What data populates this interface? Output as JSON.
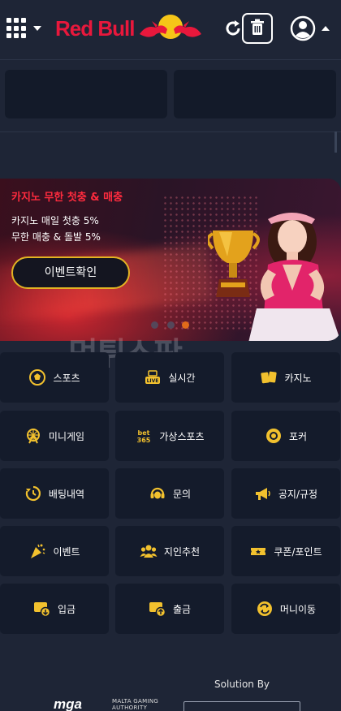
{
  "header": {
    "logo_text": "Red Bull",
    "icons": {
      "menu": "grid-icon",
      "refresh": "refresh-icon",
      "trash": "trash-icon",
      "user": "user-icon"
    }
  },
  "banner": {
    "title": "카지노 무한 첫충 & 매충",
    "line1": "카지노 매일 첫충 5%",
    "line2": "무한 매충 & 돌발 5%",
    "button_label": "이벤트확인",
    "pager": {
      "count": 3,
      "active_index": 2
    },
    "colors": {
      "title": "#ff2b3e",
      "button_border": "#e2b323",
      "active_dot": "#e06a1a"
    }
  },
  "watermark": {
    "text": "먹튀스팟"
  },
  "menu": [
    {
      "label": "스포츠",
      "icon": "soccer-ball-icon"
    },
    {
      "label": "실시간",
      "icon": "live-icon"
    },
    {
      "label": "카지노",
      "icon": "cards-icon"
    },
    {
      "label": "미니게임",
      "icon": "ferris-wheel-icon"
    },
    {
      "label": "가상스포츠",
      "icon": "bet365-icon"
    },
    {
      "label": "포커",
      "icon": "poker-chip-icon"
    },
    {
      "label": "배팅내역",
      "icon": "history-icon"
    },
    {
      "label": "문의",
      "icon": "support-icon"
    },
    {
      "label": "공지/규정",
      "icon": "megaphone-icon"
    },
    {
      "label": "이벤트",
      "icon": "party-popper-icon"
    },
    {
      "label": "지인추천",
      "icon": "people-icon"
    },
    {
      "label": "쿠폰/포인트",
      "icon": "ticket-icon"
    },
    {
      "label": "입금",
      "icon": "deposit-icon"
    },
    {
      "label": "출금",
      "icon": "withdraw-icon"
    },
    {
      "label": "머니이동",
      "icon": "money-transfer-icon"
    }
  ],
  "footer": {
    "solution_by": "Solution By",
    "mga_mark": "mga",
    "mga_line1": "MALTA GAMING",
    "mga_line2": "AUTHORITY"
  },
  "colors": {
    "background": "#1e2536",
    "tile": "#141b2b",
    "accent_gold": "#f2c12e",
    "brand_red": "#e8183c"
  }
}
